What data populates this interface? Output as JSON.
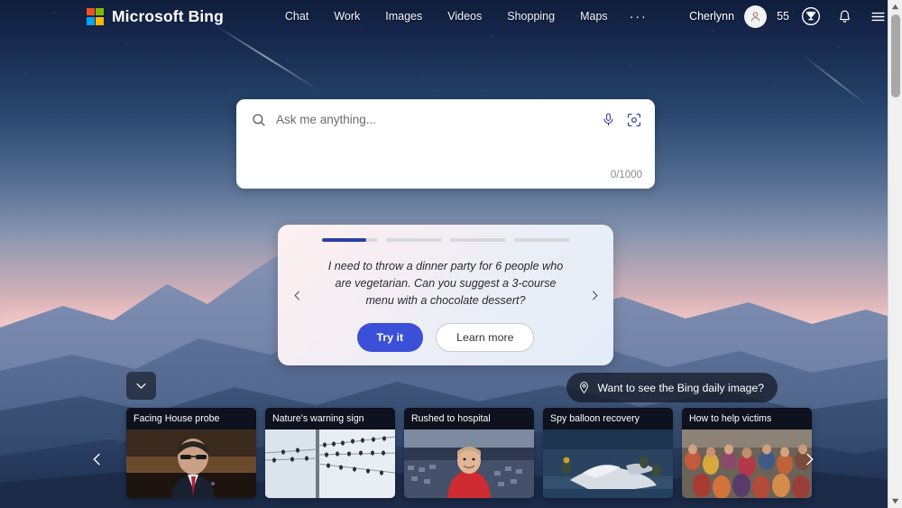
{
  "header": {
    "brand": "Microsoft Bing",
    "logo_colors": [
      "#f25022",
      "#7fba00",
      "#00a4ef",
      "#ffb900"
    ],
    "nav_items": [
      {
        "label": "Chat",
        "name": "nav-chat"
      },
      {
        "label": "Work",
        "name": "nav-work"
      },
      {
        "label": "Images",
        "name": "nav-images"
      },
      {
        "label": "Videos",
        "name": "nav-videos"
      },
      {
        "label": "Shopping",
        "name": "nav-shopping"
      },
      {
        "label": "Maps",
        "name": "nav-maps"
      }
    ],
    "more_label": "···",
    "user_name": "Cherlynn",
    "rewards_points": "55",
    "avatar_icon": "person-icon",
    "rewards_icon": "trophy-icon",
    "notifications_icon": "bell-icon",
    "menu_icon": "hamburger-menu-icon"
  },
  "search": {
    "placeholder": "Ask me anything...",
    "value": "",
    "char_counter": "0/1000",
    "search_icon": "search-icon",
    "mic_icon": "microphone-icon",
    "visual_icon": "visual-search-camera-icon"
  },
  "suggestion_card": {
    "prompt": "I need to throw a dinner party for 6 people who are vegetarian. Can you suggest a 3-course menu with a chocolate dessert?",
    "try_label": "Try it",
    "learn_label": "Learn more",
    "prev_icon": "chevron-left-icon",
    "next_icon": "chevron-right-icon",
    "progress": [
      {
        "fill_percent": 80
      },
      {
        "fill_percent": 0
      },
      {
        "fill_percent": 0
      },
      {
        "fill_percent": 0
      }
    ],
    "accent_color": "#3b4fd8",
    "progress_active_color": "#2b3ea8"
  },
  "daily_image": {
    "label": "Want to see the Bing daily image?",
    "icon": "info-pin-icon"
  },
  "collapse_button": {
    "icon": "chevron-down-icon"
  },
  "news": {
    "prev_icon": "chevron-left-icon",
    "next_icon": "chevron-right-icon",
    "cards": [
      {
        "title": "Facing House probe",
        "image": "man-in-suit-with-glasses-in-chamber"
      },
      {
        "title": "Nature's warning sign",
        "image": "birds-on-power-lines-pale-sky"
      },
      {
        "title": "Rushed to hospital",
        "image": "man-in-red-shirt-at-stadium"
      },
      {
        "title": "Spy balloon recovery",
        "image": "balloon-debris-recovery-at-sea"
      },
      {
        "title": "How to help victims",
        "image": "crowd-of-people"
      }
    ]
  },
  "scrollbar": {
    "up_icon": "scroll-up-arrow-icon",
    "down_icon": "scroll-down-arrow-icon"
  }
}
